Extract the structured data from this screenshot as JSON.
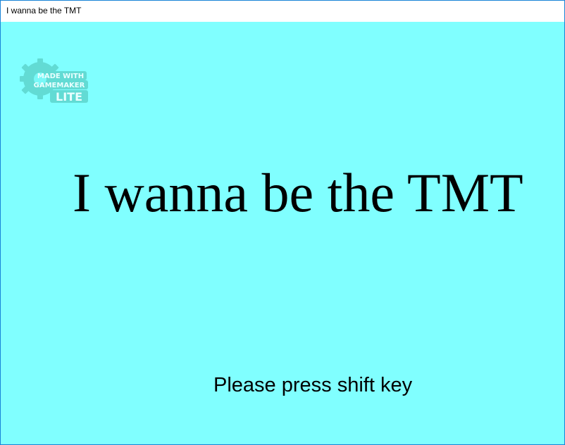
{
  "window": {
    "title": "I wanna be the TMT"
  },
  "game": {
    "background_color": "#80ffff",
    "logo": {
      "icon": "gamemaker-gear-logo-icon",
      "line1": "MADE WITH",
      "line2": "GAMEMAKER",
      "line3": "LITE"
    },
    "title": "I wanna be the TMT",
    "prompt": "Please press shift key"
  }
}
